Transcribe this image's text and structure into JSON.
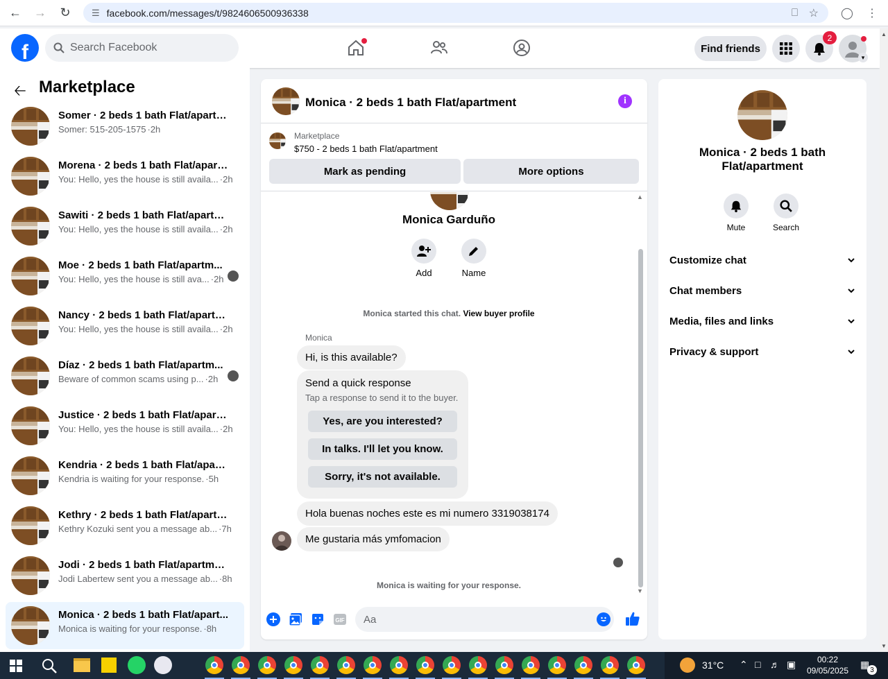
{
  "browser": {
    "url": "facebook.com/messages/t/9824606500936338"
  },
  "header": {
    "search_placeholder": "Search Facebook",
    "find_friends": "Find friends",
    "notifications_count": "2"
  },
  "sidebar": {
    "title": "Marketplace",
    "conversations": [
      {
        "name": "Somer · 2 beds 1 bath Flat/apartm...",
        "snippet": "Somer: 515-205-1575",
        "time": "·2h",
        "active": false
      },
      {
        "name": "Morena · 2 beds 1 bath Flat/apart...",
        "snippet": "You: Hello, yes the house is still availa...",
        "time": "·2h",
        "active": false
      },
      {
        "name": "Sawiti · 2 beds 1 bath Flat/apartme...",
        "snippet": "You: Hello, yes the house is still availa...",
        "time": "·2h",
        "active": false
      },
      {
        "name": "Moe · 2 beds 1 bath Flat/apartm...",
        "snippet": "You: Hello, yes the house is still ava...",
        "time": "·2h",
        "active": false
      },
      {
        "name": "Nancy · 2 beds 1 bath Flat/apartm...",
        "snippet": "You: Hello, yes the house is still availa...",
        "time": "·2h",
        "active": false
      },
      {
        "name": "Díaz · 2 beds 1 bath Flat/apartm...",
        "snippet": "Beware of common scams using p...",
        "time": "·2h",
        "active": false
      },
      {
        "name": "Justice · 2 beds 1 bath Flat/apartm...",
        "snippet": "You: Hello, yes the house is still availa...",
        "time": "·2h",
        "active": false
      },
      {
        "name": "Kendria · 2 beds 1 bath Flat/apart...",
        "snippet": "Kendria is waiting for your response.",
        "time": "·5h",
        "active": false
      },
      {
        "name": "Kethry · 2 beds 1 bath Flat/apartm...",
        "snippet": "Kethry Kozuki sent you a message ab...",
        "time": "·7h",
        "active": false
      },
      {
        "name": "Jodi · 2 beds 1 bath Flat/apartment",
        "snippet": "Jodi Labertew sent you a message ab...",
        "time": "·8h",
        "active": false
      },
      {
        "name": "Monica · 2 beds 1 bath Flat/apart...",
        "snippet": "Monica is waiting for your response.",
        "time": "·8h",
        "active": true
      }
    ]
  },
  "chat": {
    "title": "Monica · 2 beds 1 bath Flat/apartment",
    "listing_source": "Marketplace",
    "listing_price": "$750 - 2 beds 1 bath Flat/apartment",
    "mark_pending": "Mark as pending",
    "more_options": "More options",
    "profile_name": "Monica Garduño",
    "add_label": "Add",
    "name_label": "Name",
    "started_text": "Monica started this chat.",
    "view_profile": "View buyer profile",
    "sender_name": "Monica",
    "msg1": "Hi, is this available?",
    "quick_title": "Send a quick response",
    "quick_sub": "Tap a response to send it to the buyer.",
    "quick_options": [
      "Yes, are you interested?",
      "In talks. I'll let you know.",
      "Sorry, it's not available."
    ],
    "msg2": "Hola buenas noches este es mi numero 3319038174",
    "msg3": "Me gustaria más ymfomacion",
    "waiting": "Monica is waiting for your response.",
    "composer_placeholder": "Aa"
  },
  "right_panel": {
    "title": "Monica · 2 beds 1 bath Flat/apartment",
    "mute": "Mute",
    "search": "Search",
    "sections": [
      "Customize chat",
      "Chat members",
      "Media, files and links",
      "Privacy & support"
    ]
  },
  "taskbar": {
    "temperature": "31°C",
    "time": "00:22",
    "date": "09/05/2025",
    "notif_count": "3"
  },
  "colors": {
    "brand": "#0866ff",
    "active_bg": "#ebf5ff",
    "badge": "#e41e3f",
    "info": "#a033ff"
  }
}
